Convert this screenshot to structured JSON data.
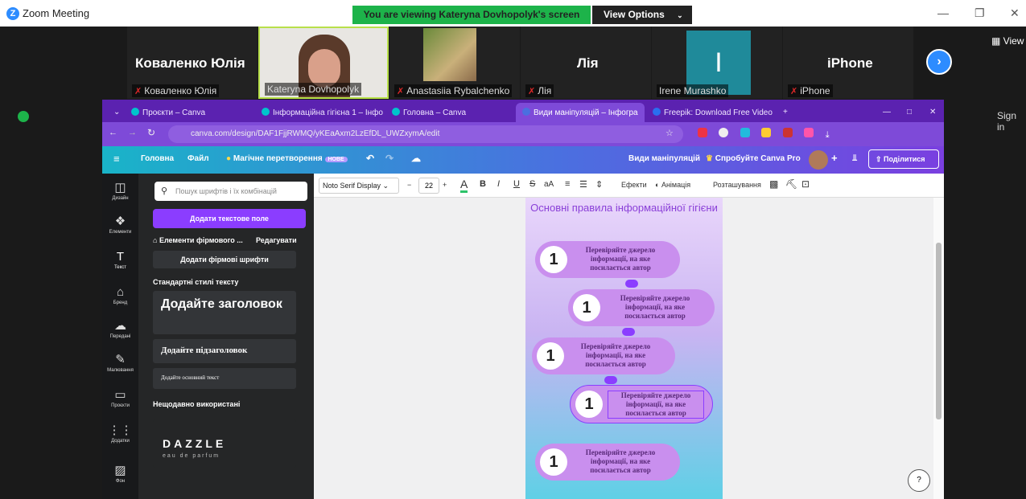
{
  "zoom": {
    "title": "Zoom Meeting",
    "view_banner": "You are viewing Kateryna Dovhopolyk's screen",
    "view_options": "View Options",
    "view_right": "View",
    "sign_in": "Sign in",
    "participants": [
      {
        "display": "Коваленко Юлія",
        "label": "Коваленко Юлія",
        "muted": true
      },
      {
        "display": "",
        "label": "Kateryna Dovhopolyk",
        "muted": false
      },
      {
        "display": "",
        "label": "Anastasiia Rybalchenko",
        "muted": true
      },
      {
        "display": "Лія",
        "label": "Лія",
        "muted": true
      },
      {
        "display": "I",
        "label": "Irene Murashko",
        "muted": false
      },
      {
        "display": "iPhone",
        "label": "iPhone",
        "muted": true
      }
    ]
  },
  "browser": {
    "tabs": [
      "Проєкти – Canva",
      "Інформаційна гігієна 1 – Інфо",
      "Головна – Canva",
      "Види маніпуляцій – Інфогра",
      "Freepik: Download Free Video"
    ],
    "url": "canva.com/design/DAF1FjjRWMQ/yKEaAxm2LzEfDL_UWZxymA/edit"
  },
  "canva": {
    "toolbar": {
      "home": "Головна",
      "file": "Файл",
      "magic": "Магічне перетворення",
      "new_badge": "НОВЕ",
      "doc_title": "Види маніпуляцій",
      "try_pro": "Спробуйте Canva Pro",
      "share": "Поділитися"
    },
    "rail": [
      {
        "label": "Дизайн",
        "icon": "design-icon"
      },
      {
        "label": "Елементи",
        "icon": "elements-icon"
      },
      {
        "label": "Текст",
        "icon": "text-icon"
      },
      {
        "label": "Бренд",
        "icon": "brand-icon"
      },
      {
        "label": "Передані",
        "icon": "uploads-icon"
      },
      {
        "label": "Малювання",
        "icon": "draw-icon"
      },
      {
        "label": "Проєкти",
        "icon": "projects-icon"
      },
      {
        "label": "Додатки",
        "icon": "apps-icon"
      },
      {
        "label": "Фон",
        "icon": "background-icon"
      }
    ],
    "panel": {
      "search_placeholder": "Пошук шрифтів і їх комбінацій",
      "add_text": "Додати текстове поле",
      "brand_elements": "Елементи фірмового ...",
      "edit": "Редагувати",
      "add_brand_fonts": "Додати фірмові шрифти",
      "standard_styles": "Стандартні стилі тексту",
      "heading": "Додайте заголовок",
      "subheading": "Додайте підзаголовок",
      "body": "Додайте основний текст",
      "recent": "Нещодавно використані",
      "dazzle": "DAZZLE",
      "dazzle_sub": "eau de parfum"
    },
    "format": {
      "font": "Noto Serif Display",
      "size": "22",
      "effects": "Ефекти",
      "animate": "Анімація",
      "position": "Розташування"
    },
    "page": {
      "title": "Основні правила інформаційної гігієни",
      "item_text": "Перевіряйте джерело інформації, на яке посилається автор",
      "item_number": "1"
    }
  }
}
